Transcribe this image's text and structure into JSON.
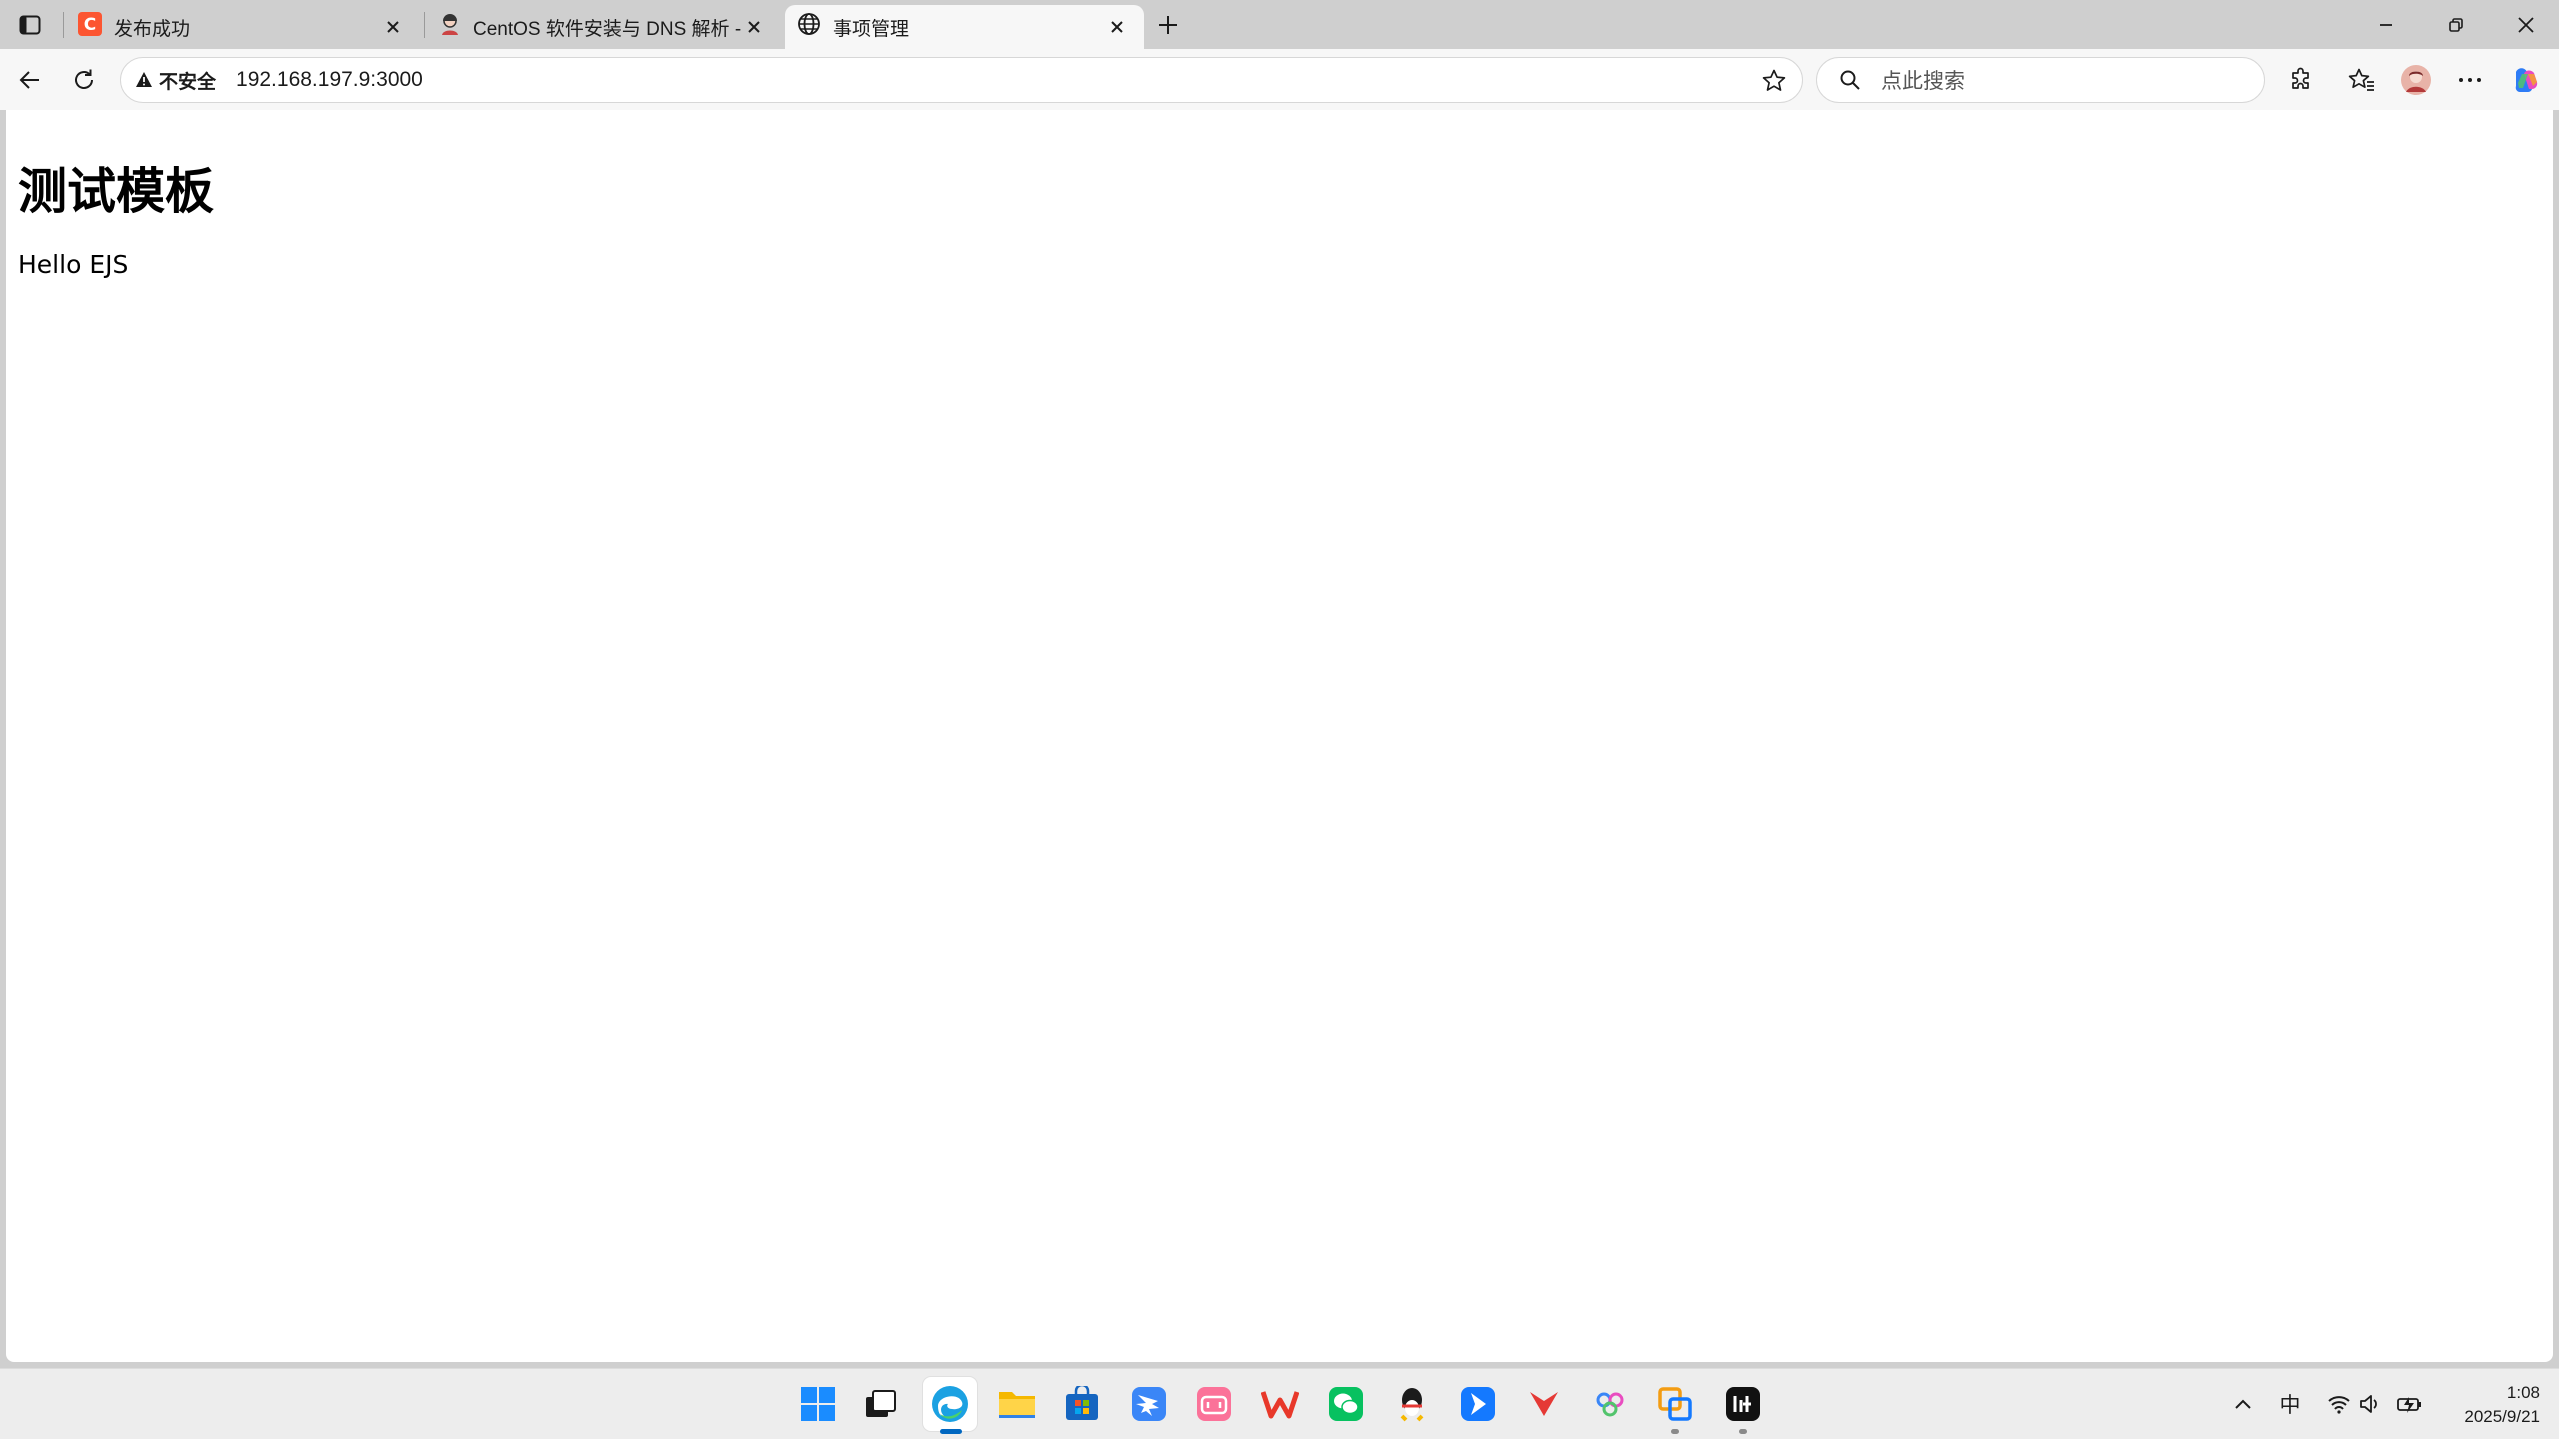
{
  "browser": {
    "tabs": [
      {
        "title": "发布成功",
        "icon": "csdn-icon"
      },
      {
        "title": "CentOS 软件安装与 DNS 解析 - 王",
        "icon": "avatar-icon"
      },
      {
        "title": "事项管理",
        "icon": "globe-icon"
      }
    ],
    "address": {
      "security_label": "不安全",
      "url": "192.168.197.9:3000"
    },
    "search": {
      "placeholder": "点此搜索"
    }
  },
  "page": {
    "heading": "测试模板",
    "text": "Hello EJS"
  },
  "taskbar": {
    "ime_label": "中",
    "time": "1:08",
    "date": "2025/9/21"
  },
  "colors": {
    "accent": "#0067c0",
    "tab_bar": "#cfcfcf",
    "toolbar": "#f7f7f7"
  }
}
